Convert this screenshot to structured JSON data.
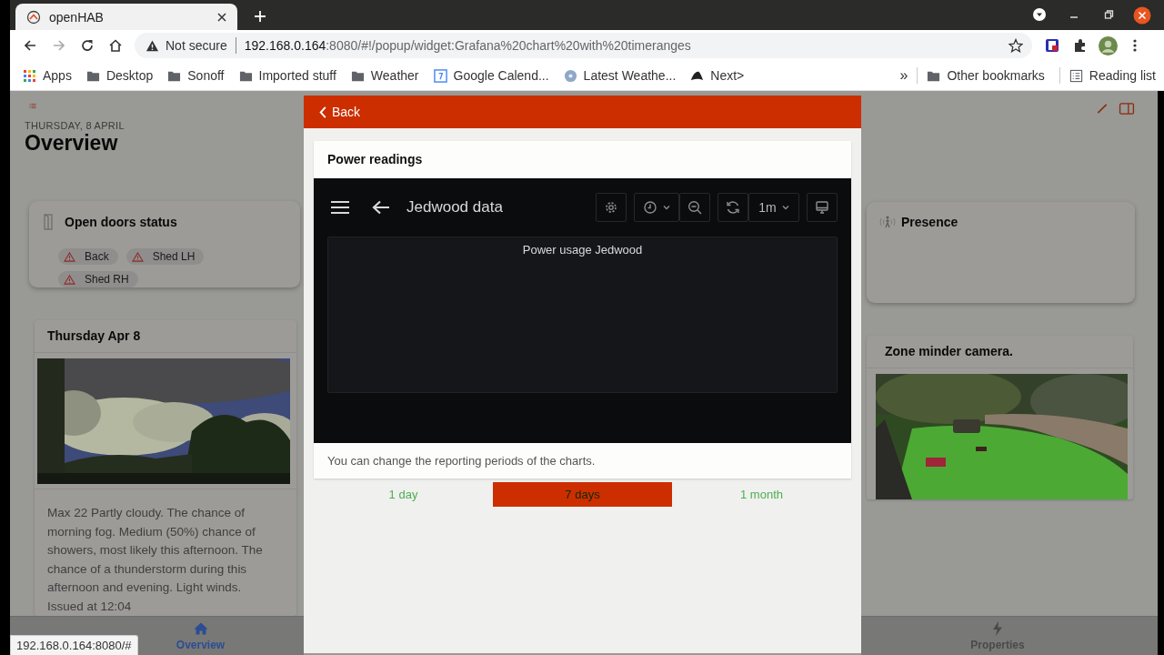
{
  "browser": {
    "tabs": [
      {
        "title": "openHAB",
        "selected": true
      }
    ],
    "security": "Not secure",
    "url_host": "192.168.0.164",
    "url_rest": ":8080/#!/popup/widget:Grafana%20chart%20with%20timeranges",
    "bookmarks": [
      {
        "label": "Apps",
        "kind": "apps"
      },
      {
        "label": "Desktop",
        "kind": "folder"
      },
      {
        "label": "Sonoff",
        "kind": "folder"
      },
      {
        "label": "Imported stuff",
        "kind": "folder"
      },
      {
        "label": "Weather",
        "kind": "folder"
      },
      {
        "label": "Google Calend...",
        "kind": "calendar"
      },
      {
        "label": "Latest Weathe...",
        "kind": "disc"
      },
      {
        "label": "Next>",
        "kind": "hat"
      }
    ],
    "overflow": "»",
    "other_bookmarks": "Other bookmarks",
    "reading_list": "Reading list"
  },
  "page": {
    "date": "THURSDAY, 8 APRIL",
    "title": "Overview",
    "doors_card": {
      "title": "Open doors status",
      "chips": [
        "Back",
        "Shed LH",
        "Shed RH"
      ]
    },
    "weather_card": {
      "title": "Thursday Apr 8",
      "text": "Max 22 Partly cloudy. The chance of morning fog. Medium (50%) chance of showers, most likely this afternoon. The chance of a thunderstorm during this afternoon and evening. Light winds. Issued at 12:04"
    },
    "presence_card": {
      "title": "Presence"
    },
    "camera_card": {
      "title": "Zone minder camera."
    },
    "bottom_tabs": [
      {
        "label": "Overview",
        "selected": true
      },
      {
        "label": "Properties",
        "selected": false
      }
    ]
  },
  "popup": {
    "back": "Back",
    "card_title": "Power readings",
    "dashboard": {
      "title": "Jedwood data",
      "refresh": "1m",
      "panel_title": "Power usage Jedwood"
    },
    "note": "You can change the reporting periods of the charts.",
    "ranges": [
      {
        "label": "1 day",
        "selected": false
      },
      {
        "label": "7 days",
        "selected": true
      },
      {
        "label": "1 month",
        "selected": false
      }
    ]
  },
  "status_url": "192.168.0.164:8080/#"
}
